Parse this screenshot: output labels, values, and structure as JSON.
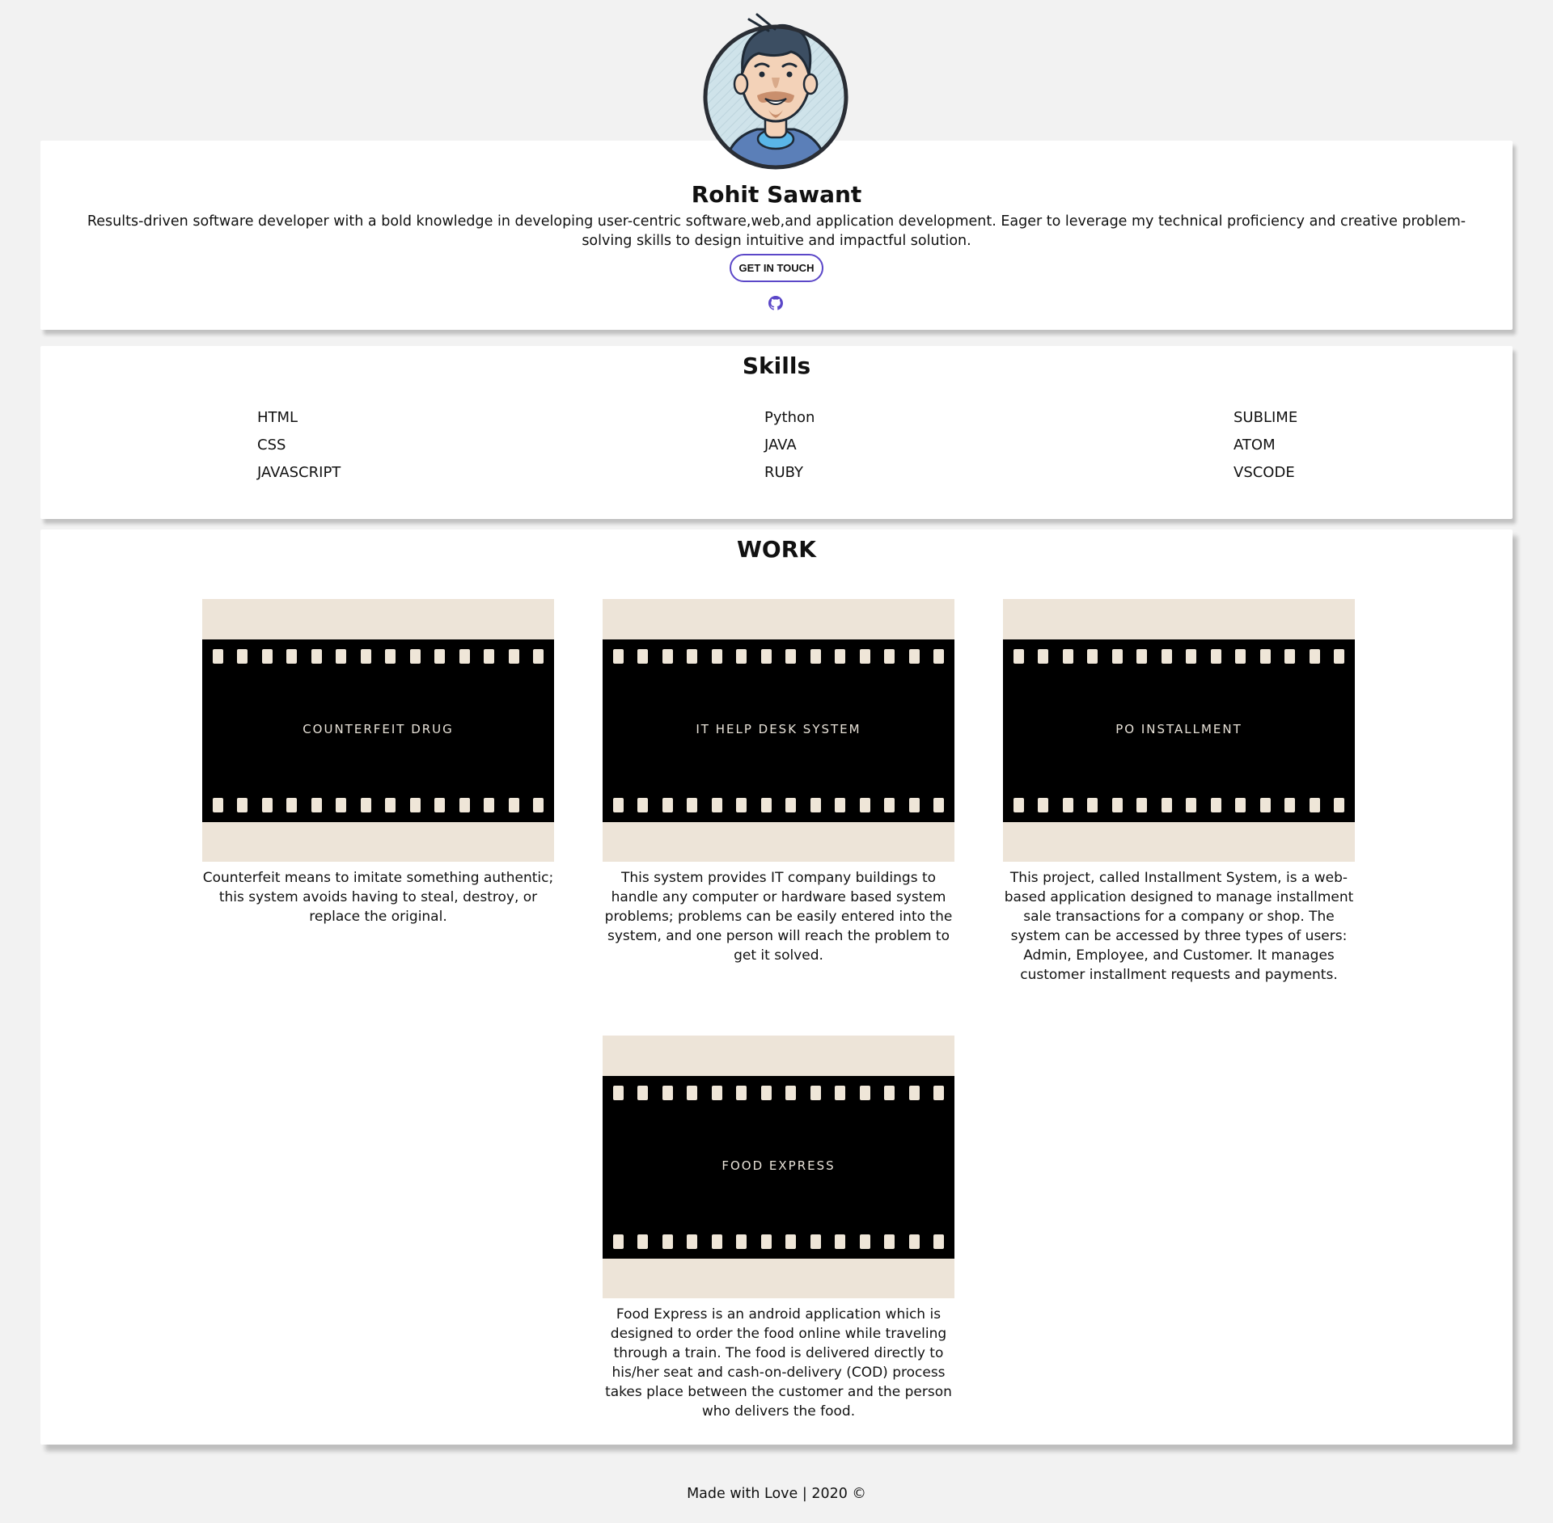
{
  "profile": {
    "name": "Rohit Sawant",
    "bio": "Results-driven software developer with a bold knowledge in developing user-centric software,web,and application development. Eager to leverage my technical proficiency and creative problem-solving skills to design intuitive and impactful solution.",
    "cta_label": "GET IN TOUCH",
    "avatar_icon": "developer-avatar",
    "social_icon": "github-icon"
  },
  "skills": {
    "title": "Skills",
    "columns": [
      [
        "HTML",
        "CSS",
        "JAVASCRIPT"
      ],
      [
        "Python",
        "JAVA",
        "RUBY"
      ],
      [
        "SUBLIME",
        "ATOM",
        "VSCODE"
      ]
    ]
  },
  "work": {
    "title": "WORK",
    "items": [
      {
        "label": "COUNTERFEIT DRUG",
        "description": "Counterfeit means to imitate something authentic; this system avoids having to steal, destroy, or replace the original."
      },
      {
        "label": "IT HELP DESK SYSTEM",
        "description": "This system provides IT company buildings to handle any computer or hardware based system problems; problems can be easily entered into the system, and one person will reach the problem to get it solved."
      },
      {
        "label": "PO INSTALLMENT",
        "description": "This project, called Installment System, is a web-based application designed to manage installment sale transactions for a company or shop. The system can be accessed by three types of users: Admin, Employee, and Customer. It manages customer installment requests and payments."
      },
      {
        "label": "FOOD EXPRESS",
        "description": "Food Express is an android application which is designed to order the food online while traveling through a train. The food is delivered directly to his/her seat and cash-on-delivery (COD) process takes place between the customer and the person who delivers the food."
      }
    ]
  },
  "footer": {
    "text": "Made with Love | 2020 ©"
  },
  "colors": {
    "accent": "#5b47c8",
    "page_bg": "#f2f2f2",
    "thumb_bg": "#ede4d8"
  }
}
